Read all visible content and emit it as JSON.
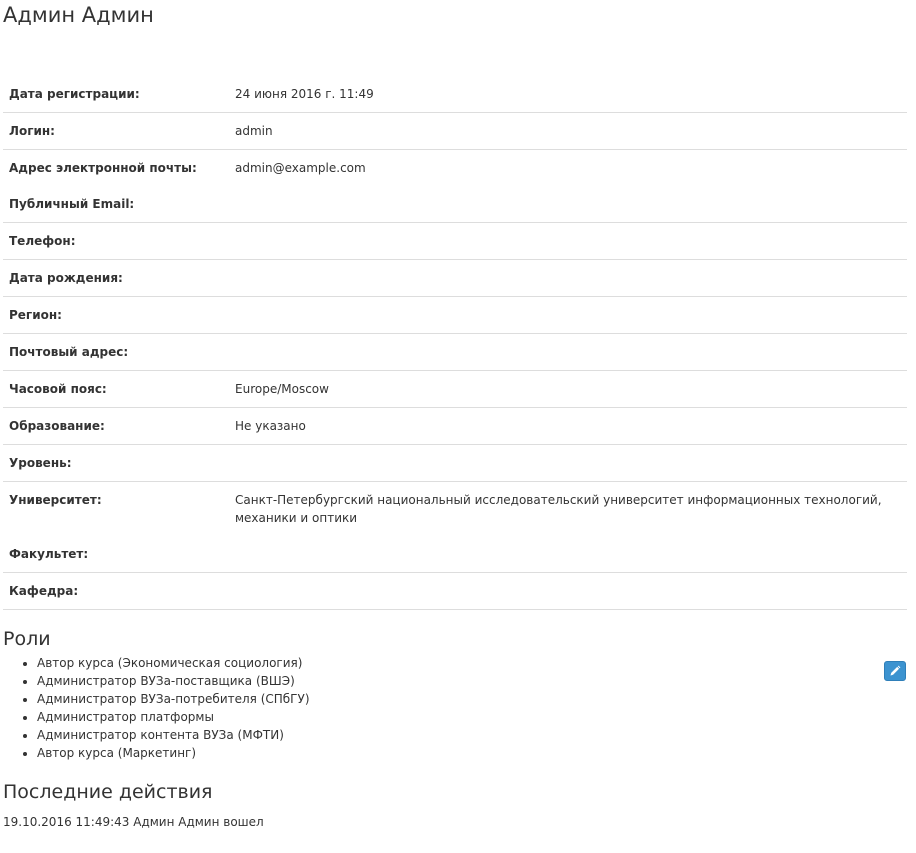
{
  "profile": {
    "name": "Админ Админ",
    "fields": [
      {
        "label": "Дата регистрации:",
        "value": "24 июня 2016 г. 11:49"
      },
      {
        "label": "Логин:",
        "value": "admin"
      },
      {
        "label": "Адрес электронной почты:",
        "value": "admin@example.com"
      },
      {
        "label": "Публичный Email:",
        "value": ""
      },
      {
        "label": "Телефон:",
        "value": ""
      },
      {
        "label": "Дата рождения:",
        "value": ""
      },
      {
        "label": "Регион:",
        "value": ""
      },
      {
        "label": "Почтовый адрес:",
        "value": ""
      },
      {
        "label": "Часовой пояс:",
        "value": "Europe/Moscow"
      },
      {
        "label": "Образование:",
        "value": "Не указано"
      },
      {
        "label": "Уровень:",
        "value": ""
      },
      {
        "label": "Университет:",
        "value": "Санкт-Петербургский национальный исследовательский университет информационных технологий, механики и оптики"
      },
      {
        "label": "Факультет:",
        "value": ""
      },
      {
        "label": "Кафедра:",
        "value": ""
      }
    ]
  },
  "roles": {
    "title": "Роли",
    "edit_icon": "pencil-icon",
    "accent_color": "#3c93d0",
    "items": [
      "Автор курса (Экономическая социология)",
      "Администратор ВУЗа-поставщика (ВШЭ)",
      "Администратор ВУЗа-потребителя (СПбГУ)",
      "Администратор платформы",
      "Администратор контента ВУЗа (МФТИ)",
      "Автор курса (Маркетинг)"
    ]
  },
  "recent": {
    "title": "Последние действия",
    "items": [
      "19.10.2016 11:49:43 Админ Админ вошел"
    ]
  }
}
